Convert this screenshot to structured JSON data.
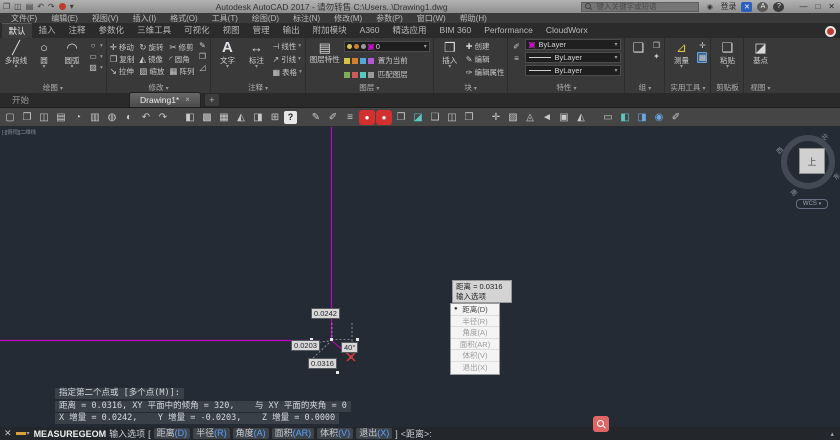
{
  "icons": {
    "caret_down": "▾",
    "caret_right": "▸",
    "close": "×",
    "plus": "+",
    "minimize": "—",
    "maximize": "□",
    "close_win": "✕",
    "bullet": "●",
    "question": "?",
    "person": "◉",
    "exchange": "✕",
    "a360": "A",
    "undo": "↶",
    "redo": "↷",
    "open": "❐",
    "save": "◫",
    "print": "▤",
    "ellipse": "○",
    "rect": "▭",
    "hatch": "▨",
    "up_caret": "▴"
  },
  "title_bar": {
    "title": "Autodesk AutoCAD 2017 - 请勿转售    C:\\Users..\\Drawing1.dwg",
    "search_placeholder": "键入关键字或短语",
    "signin": "登录"
  },
  "menu_bar": {
    "items": [
      "文件(F)",
      "编辑(E)",
      "视图(V)",
      "插入(I)",
      "格式(O)",
      "工具(T)",
      "绘图(D)",
      "标注(N)",
      "修改(M)",
      "参数(P)",
      "窗口(W)",
      "帮助(H)"
    ]
  },
  "ribbon_tabs": {
    "items": [
      {
        "label": "默认",
        "cls": "active"
      },
      {
        "label": "插入"
      },
      {
        "label": "注释"
      },
      {
        "label": "参数化"
      },
      {
        "label": "三维工具"
      },
      {
        "label": "可视化"
      },
      {
        "label": "视图"
      },
      {
        "label": "管理"
      },
      {
        "label": "输出"
      },
      {
        "label": "附加模块"
      },
      {
        "label": "A360"
      },
      {
        "label": "精选应用"
      },
      {
        "label": "BIM 360"
      },
      {
        "label": "Performance"
      },
      {
        "label": "CloudWorx"
      }
    ]
  },
  "ribbon": {
    "draw": {
      "label": "绘图",
      "buttons": [
        {
          "label": "多段线",
          "glyph": "╱"
        },
        {
          "label": "圆",
          "glyph": "○"
        },
        {
          "label": "圆弧",
          "glyph": "◠"
        }
      ]
    },
    "modify": {
      "label": "修改",
      "tools": [
        {
          "label": "移动",
          "glyph": "✛"
        },
        {
          "label": "旋转",
          "glyph": "↻"
        },
        {
          "label": "修剪",
          "glyph": "✂"
        },
        {
          "label": "复制",
          "glyph": "❐"
        },
        {
          "label": "镜像",
          "glyph": "◭"
        },
        {
          "label": "圆角",
          "glyph": "◜"
        },
        {
          "label": "拉伸",
          "glyph": "↘"
        },
        {
          "label": "缩放",
          "glyph": "▧"
        },
        {
          "label": "阵列",
          "glyph": "▦"
        }
      ]
    },
    "annotate": {
      "label": "注释",
      "text_btn": "文字",
      "dim_btn": "标注",
      "rows": [
        {
          "label": "线性",
          "glyph": "⊣"
        },
        {
          "label": "引线",
          "glyph": "↗"
        },
        {
          "label": "表格",
          "glyph": "▦"
        }
      ]
    },
    "layers": {
      "label": "图层",
      "big": "图层特性",
      "layer_value": "0",
      "row2": "置为当前",
      "row3": "匹配图层"
    },
    "block": {
      "label": "块",
      "big": "插入",
      "rows": [
        {
          "label": "创建",
          "glyph": "✚"
        },
        {
          "label": "编辑",
          "glyph": "✎"
        },
        {
          "label": "编辑属性",
          "glyph": "✑"
        }
      ]
    },
    "props": {
      "label": "特性",
      "rows": [
        "ByLayer",
        "ByLayer",
        "ByLayer"
      ]
    },
    "groups": {
      "label": "组"
    },
    "utils": {
      "label": "实用工具",
      "big": "测量"
    },
    "clipboard": {
      "label": "剪贴板",
      "big": "粘贴"
    },
    "view": {
      "label": "视图",
      "big": "基点"
    }
  },
  "file_tabs": {
    "start": "开始",
    "drawing": "Drawing1*"
  },
  "toolbar": {
    "icons": [
      {
        "glyph": "▢"
      },
      {
        "glyph": "❐"
      },
      {
        "glyph": "◫"
      },
      {
        "glyph": "▤"
      },
      {
        "glyph": "◔"
      },
      {
        "glyph": "▥"
      },
      {
        "glyph": "◍"
      },
      {
        "glyph": "◐"
      },
      {
        "glyph": "↶"
      },
      {
        "glyph": "↷"
      },
      {
        "cls": "gap"
      },
      {
        "glyph": "◧"
      },
      {
        "glyph": "▩"
      },
      {
        "glyph": "▦"
      },
      {
        "glyph": "◭"
      },
      {
        "glyph": "◨"
      },
      {
        "glyph": "⊞"
      },
      {
        "glyph": "?",
        "cls": "help"
      },
      {
        "cls": "gap"
      },
      {
        "glyph": "✎"
      },
      {
        "glyph": "✐"
      },
      {
        "glyph": "≡"
      },
      {
        "glyph": "●",
        "cls": "red"
      },
      {
        "glyph": "●",
        "cls": "red"
      },
      {
        "glyph": "❐"
      },
      {
        "glyph": "◪",
        "cls": "teal"
      },
      {
        "glyph": "❑"
      },
      {
        "glyph": "◫"
      },
      {
        "glyph": "❒"
      },
      {
        "cls": "gap"
      },
      {
        "glyph": "✛"
      },
      {
        "glyph": "▨"
      },
      {
        "glyph": "◬"
      },
      {
        "glyph": "◄"
      },
      {
        "glyph": "▣"
      },
      {
        "glyph": "◭"
      },
      {
        "cls": "gap"
      },
      {
        "glyph": "▭"
      },
      {
        "glyph": "◧",
        "cls": "teal"
      },
      {
        "glyph": "◨",
        "cls": "blue"
      },
      {
        "glyph": "◉",
        "cls": "blue"
      },
      {
        "glyph": "✐"
      }
    ]
  },
  "canvas": {
    "viewport_label": "[-][俯视][二维线框]",
    "dim_boxes": {
      "top": "0.0242",
      "left": "0.0203",
      "angle": "40°",
      "bottom": "0.0316"
    },
    "tooltip": {
      "line1": "距离 = 0.0316",
      "line2": "输入选项"
    },
    "context_menu": {
      "items": [
        {
          "label": "距离(D)",
          "cls": "sel"
        },
        {
          "label": "半径(R)"
        },
        {
          "label": "角度(A)"
        },
        {
          "label": "面积(AR)"
        },
        {
          "label": "体积(V)"
        },
        {
          "label": "退出(X)"
        }
      ]
    },
    "prompts": [
      "指定第二个点或 [多个点(M)]:",
      "距离 = 0.0316, XY 平面中的倾角 = 320,    与 XY 平面的夹角 = 0",
      "X 增量 = 0.0242,    Y 增量 = -0.0203,    Z 增量 = 0.0000"
    ],
    "viewcube": {
      "top": "上",
      "n": "北",
      "s": "南",
      "e": "东",
      "w": "西",
      "wcs": "WCS"
    }
  },
  "command_line": {
    "command": "MEASUREGEOM",
    "prompt_label": "输入选项",
    "open_bracket": "[",
    "close_bracket": "]",
    "options": [
      {
        "label": "距离",
        "key": "(D)"
      },
      {
        "label": "半径",
        "key": "(R)"
      },
      {
        "label": "角度",
        "key": "(A)"
      },
      {
        "label": "面积",
        "key": "(AR)"
      },
      {
        "label": "体积",
        "key": "(V)"
      },
      {
        "label": "退出",
        "key": "(X)"
      }
    ],
    "suffix": "<距离>:"
  },
  "colors": {
    "accent_magenta": "#c400c4",
    "option_key_blue": "#59a0ff",
    "record_red": "#d22f2f"
  }
}
